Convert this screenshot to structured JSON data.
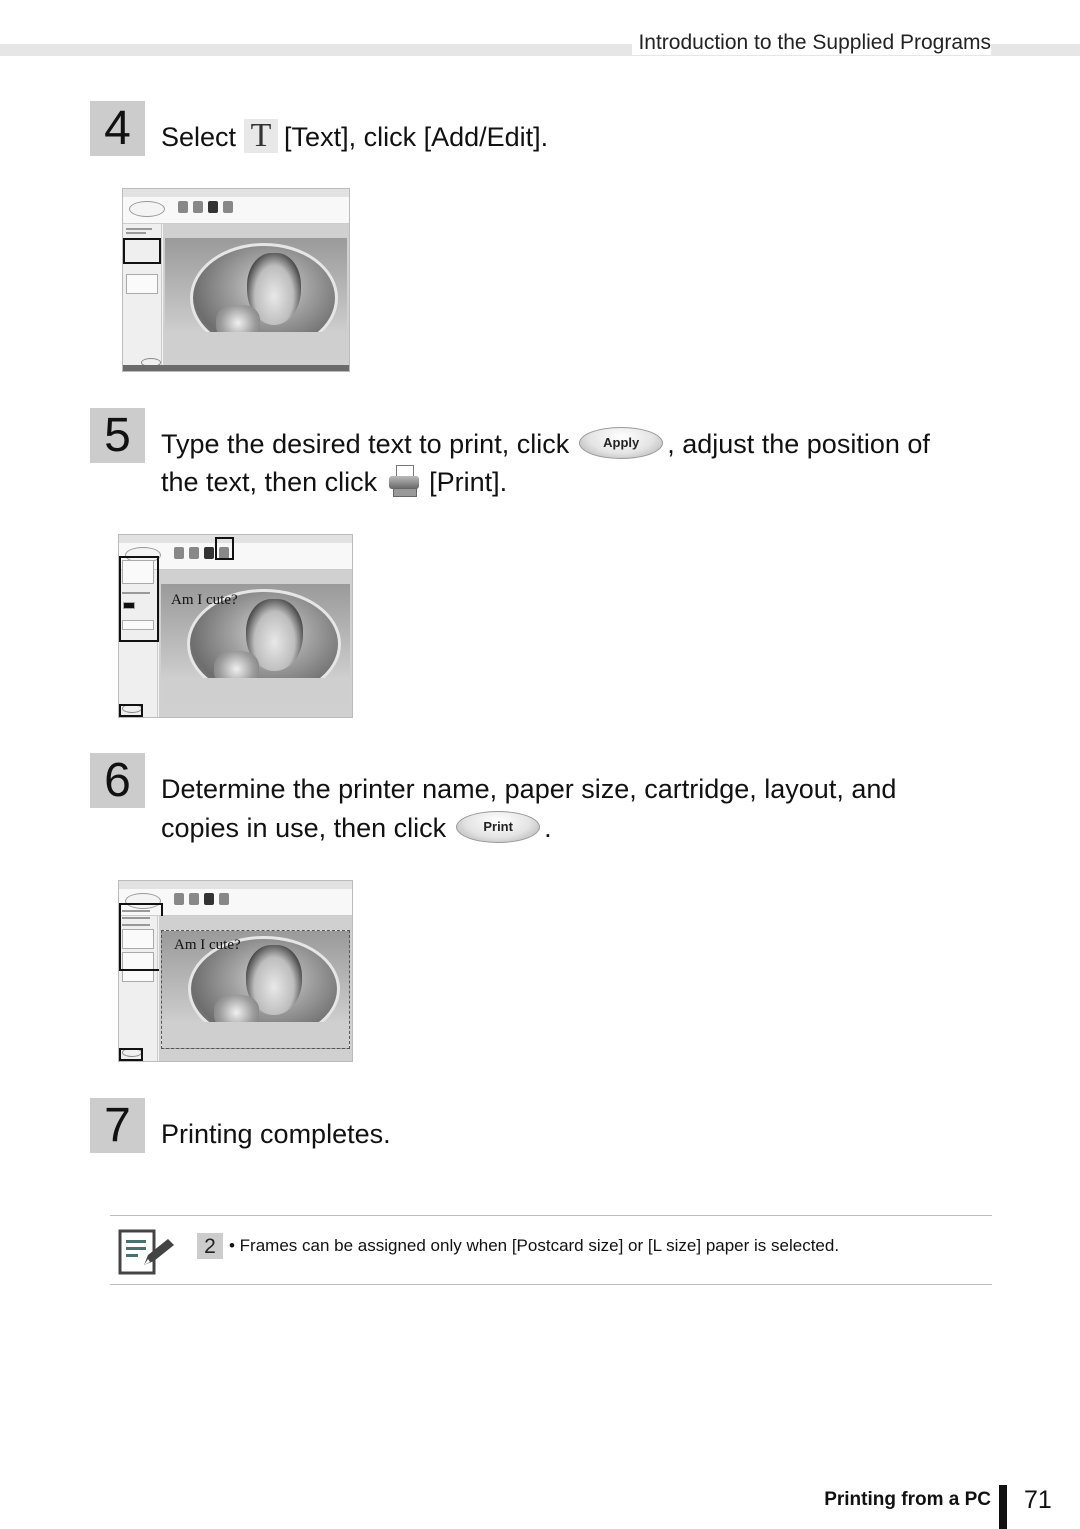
{
  "header": {
    "section_title": "Introduction to the Supplied Programs"
  },
  "steps": [
    {
      "number": "4",
      "parts": {
        "before_icon": "Select",
        "icon": "text-tool-icon",
        "icon_glyph": "T",
        "after_icon": "[Text], click [Add/Edit]."
      }
    },
    {
      "number": "5",
      "line1_before": "Type the desired text to print, click",
      "button_label": "Apply",
      "line1_after": ", adjust the position of",
      "line2_before": "the text, then click",
      "icon": "printer-icon",
      "line2_after": "[Print].",
      "screenshot_overlay_text": "Am I cute?"
    },
    {
      "number": "6",
      "line1": "Determine the printer name, paper size, cartridge, layout, and",
      "line2_before": "copies in use, then click",
      "button_label": "Print",
      "line2_after": ".",
      "screenshot_overlay_text": "Am I cute?"
    },
    {
      "number": "7",
      "text": "Printing completes."
    }
  ],
  "note": {
    "icon": "note-pencil-icon",
    "badge": "2",
    "text": "• Frames can be assigned only when [Postcard size] or [L size] paper is selected."
  },
  "footer": {
    "section_label": "Printing from a PC",
    "page_number": "71"
  }
}
